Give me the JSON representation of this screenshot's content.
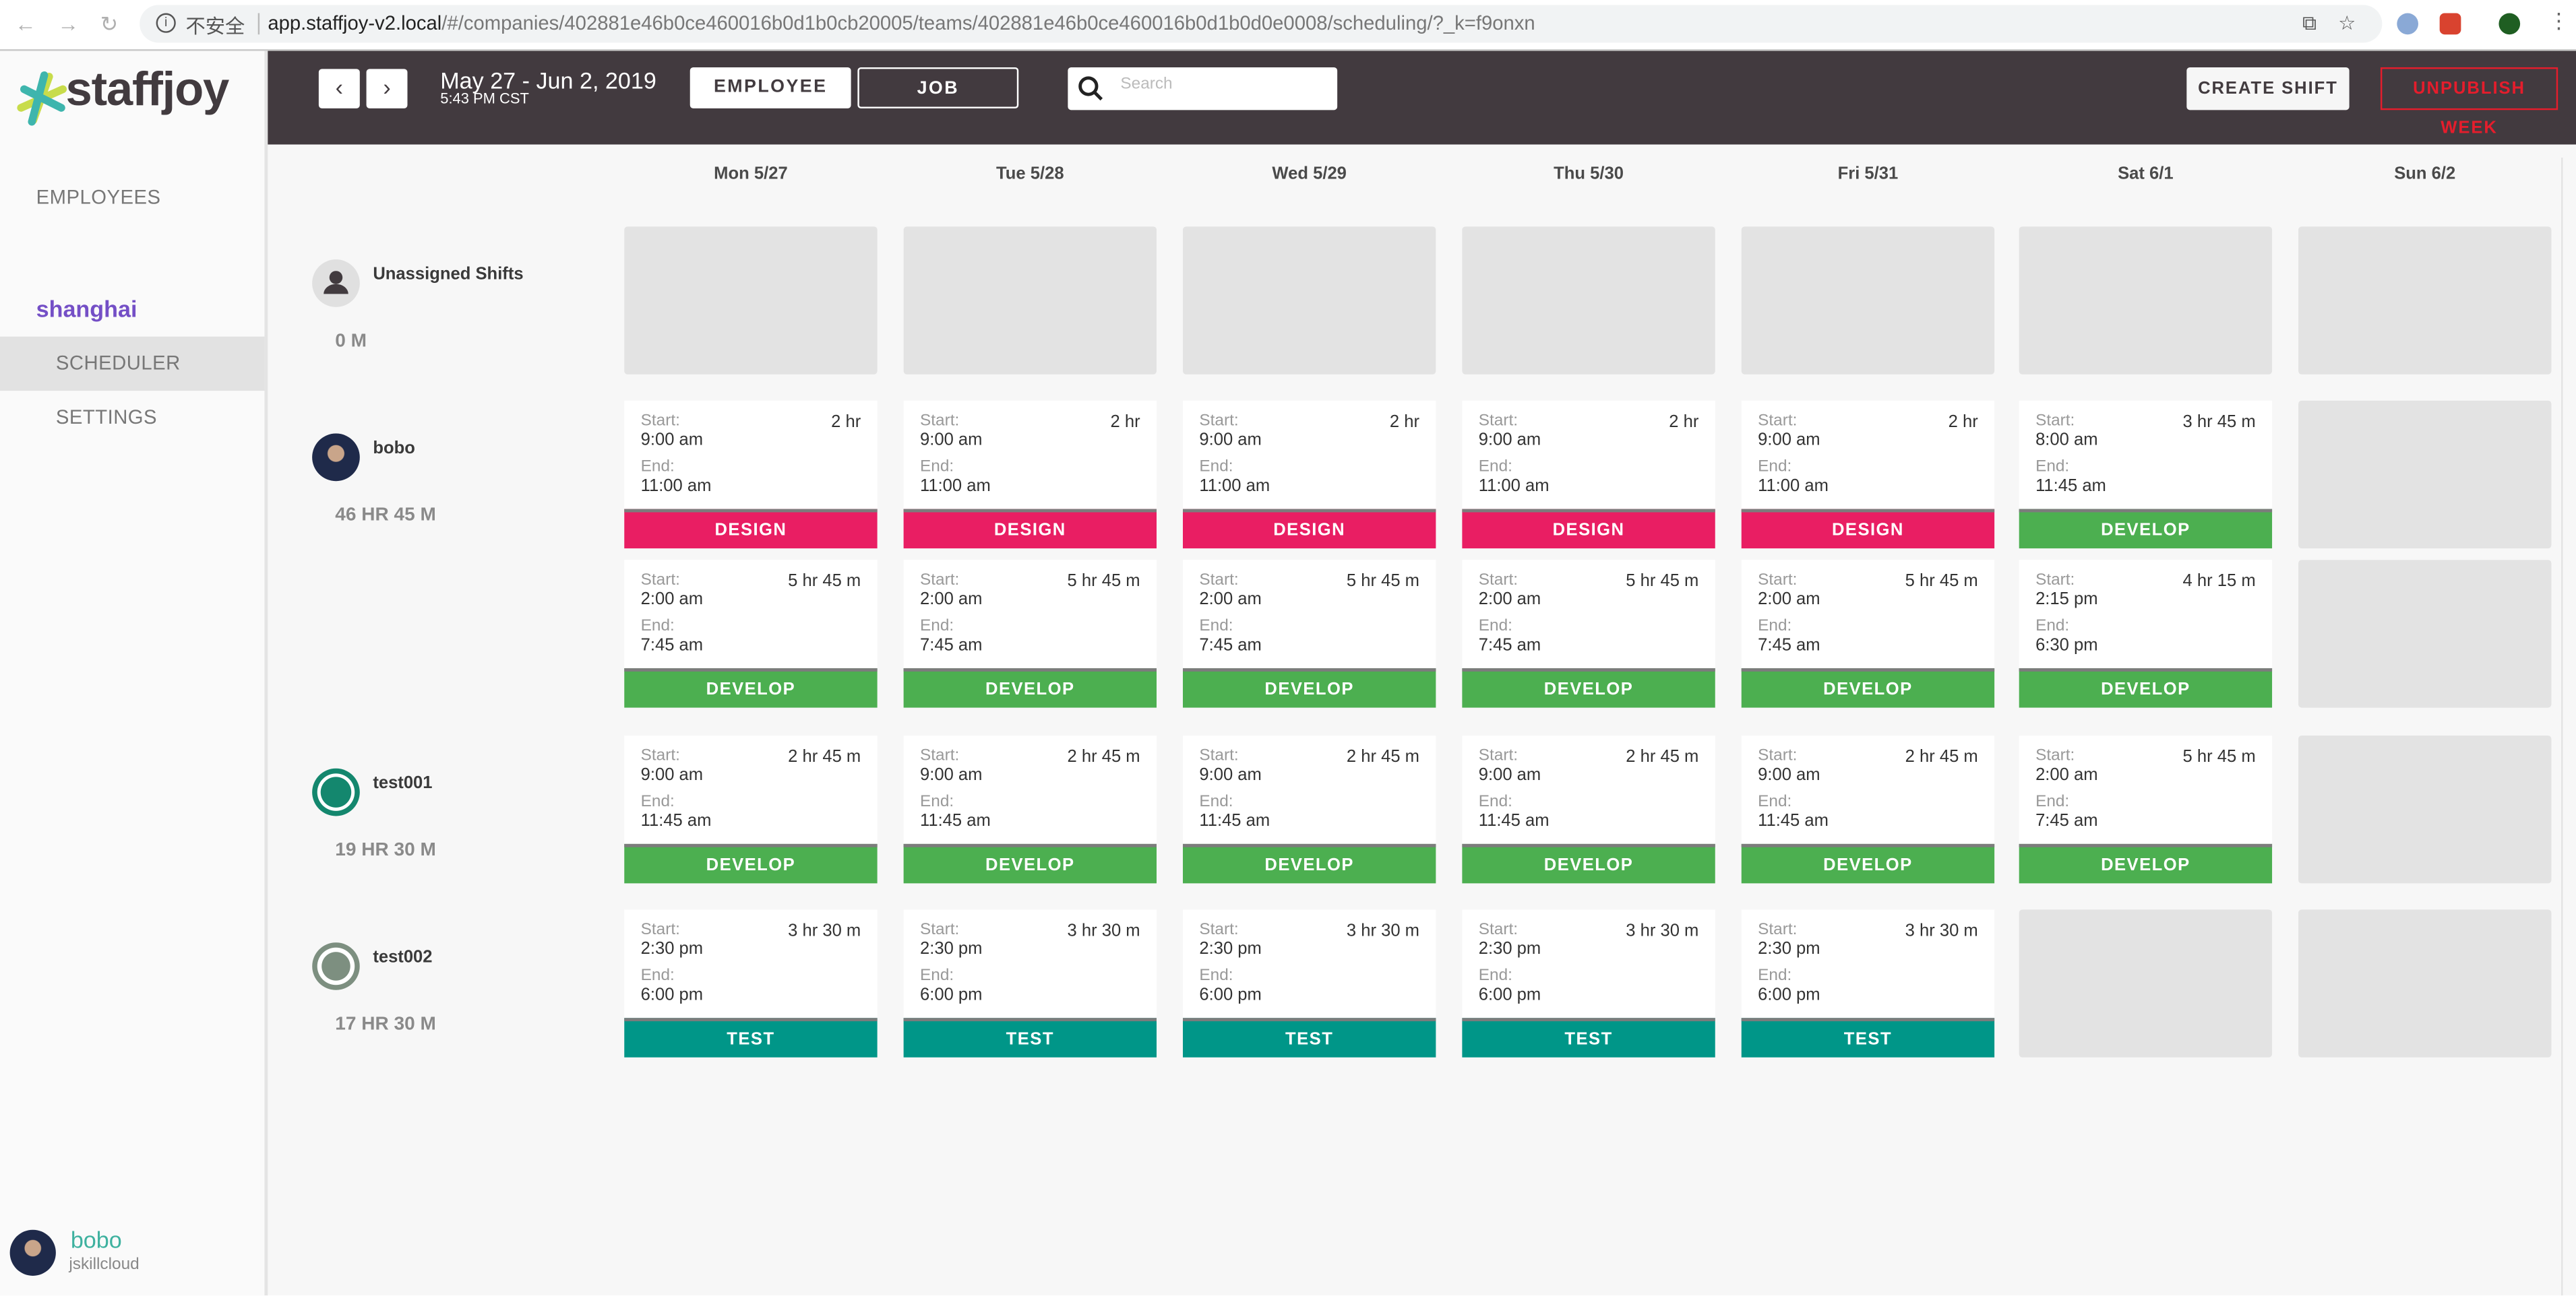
{
  "browser": {
    "insecure_label": "不安全",
    "url_host": "app.staffjoy-v2.local",
    "url_path": "/#/companies/402881e46b0ce460016b0d1b0cb20005/teams/402881e46b0ce460016b0d1b0d0e0008/scheduling/?_k=f9onxn"
  },
  "app": {
    "logo_text": "staffjoy",
    "accent": "#744fc6",
    "header_bg": "#423a3f"
  },
  "sidebar": {
    "employees_label": "EMPLOYEES",
    "team_name": "shanghai",
    "items": [
      {
        "label": "SCHEDULER",
        "active": true
      },
      {
        "label": "SETTINGS",
        "active": false
      }
    ],
    "user": {
      "name": "bobo",
      "company": "jskillcloud"
    }
  },
  "header": {
    "prev_label": "‹",
    "next_label": "›",
    "date_range": "May 27 - Jun 2, 2019",
    "current_time": "5:43 PM CST",
    "view_toggle": [
      {
        "label": "EMPLOYEE",
        "selected": true
      },
      {
        "label": "JOB",
        "selected": false
      }
    ],
    "search_placeholder": "Search",
    "search_value": "",
    "create_shift_label": "CREATE SHIFT",
    "unpublish_label": "UNPUBLISH WEEK"
  },
  "days": [
    "Mon 5/27",
    "Tue 5/28",
    "Wed 5/29",
    "Thu 5/30",
    "Fri 5/31",
    "Sat 6/1",
    "Sun 6/2"
  ],
  "labels": {
    "start": "Start:",
    "end": "End:"
  },
  "job_colors": {
    "DESIGN": "#e91e63",
    "DEVELOP": "#4caf50",
    "TEST": "#009688"
  },
  "rows": [
    {
      "name": "Unassigned Shifts",
      "hours": "0 M",
      "avatar": "placeholder",
      "lanes": [
        [
          null,
          null,
          null,
          null,
          null,
          null,
          null
        ]
      ]
    },
    {
      "name": "bobo",
      "hours": "46 HR 45 M",
      "avatar": "photo",
      "lanes": [
        [
          {
            "start": "9:00 am",
            "end": "11:00 am",
            "duration": "2 hr",
            "job": "DESIGN"
          },
          {
            "start": "9:00 am",
            "end": "11:00 am",
            "duration": "2 hr",
            "job": "DESIGN"
          },
          {
            "start": "9:00 am",
            "end": "11:00 am",
            "duration": "2 hr",
            "job": "DESIGN"
          },
          {
            "start": "9:00 am",
            "end": "11:00 am",
            "duration": "2 hr",
            "job": "DESIGN"
          },
          {
            "start": "9:00 am",
            "end": "11:00 am",
            "duration": "2 hr",
            "job": "DESIGN"
          },
          {
            "start": "8:00 am",
            "end": "11:45 am",
            "duration": "3 hr 45 m",
            "job": "DEVELOP"
          },
          null
        ],
        [
          {
            "start": "2:00 am",
            "end": "7:45 am",
            "duration": "5 hr 45 m",
            "job": "DEVELOP"
          },
          {
            "start": "2:00 am",
            "end": "7:45 am",
            "duration": "5 hr 45 m",
            "job": "DEVELOP"
          },
          {
            "start": "2:00 am",
            "end": "7:45 am",
            "duration": "5 hr 45 m",
            "job": "DEVELOP"
          },
          {
            "start": "2:00 am",
            "end": "7:45 am",
            "duration": "5 hr 45 m",
            "job": "DEVELOP"
          },
          {
            "start": "2:00 am",
            "end": "7:45 am",
            "duration": "5 hr 45 m",
            "job": "DEVELOP"
          },
          {
            "start": "2:15 pm",
            "end": "6:30 pm",
            "duration": "4 hr 15 m",
            "job": "DEVELOP"
          },
          null
        ]
      ]
    },
    {
      "name": "test001",
      "hours": "19 HR 30 M",
      "avatar": "identicon-green",
      "lanes": [
        [
          {
            "start": "9:00 am",
            "end": "11:45 am",
            "duration": "2 hr 45 m",
            "job": "DEVELOP"
          },
          {
            "start": "9:00 am",
            "end": "11:45 am",
            "duration": "2 hr 45 m",
            "job": "DEVELOP"
          },
          {
            "start": "9:00 am",
            "end": "11:45 am",
            "duration": "2 hr 45 m",
            "job": "DEVELOP"
          },
          {
            "start": "9:00 am",
            "end": "11:45 am",
            "duration": "2 hr 45 m",
            "job": "DEVELOP"
          },
          {
            "start": "9:00 am",
            "end": "11:45 am",
            "duration": "2 hr 45 m",
            "job": "DEVELOP"
          },
          {
            "start": "2:00 am",
            "end": "7:45 am",
            "duration": "5 hr 45 m",
            "job": "DEVELOP"
          },
          null
        ]
      ]
    },
    {
      "name": "test002",
      "hours": "17 HR 30 M",
      "avatar": "identicon-gray",
      "lanes": [
        [
          {
            "start": "2:30 pm",
            "end": "6:00 pm",
            "duration": "3 hr 30 m",
            "job": "TEST"
          },
          {
            "start": "2:30 pm",
            "end": "6:00 pm",
            "duration": "3 hr 30 m",
            "job": "TEST"
          },
          {
            "start": "2:30 pm",
            "end": "6:00 pm",
            "duration": "3 hr 30 m",
            "job": "TEST"
          },
          {
            "start": "2:30 pm",
            "end": "6:00 pm",
            "duration": "3 hr 30 m",
            "job": "TEST"
          },
          {
            "start": "2:30 pm",
            "end": "6:00 pm",
            "duration": "3 hr 30 m",
            "job": "TEST"
          },
          null,
          null
        ]
      ]
    }
  ]
}
